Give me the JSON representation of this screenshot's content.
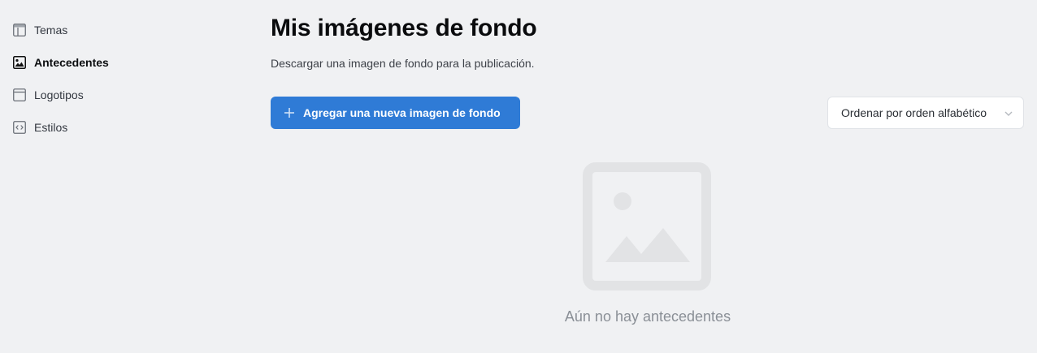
{
  "sidebar": {
    "items": [
      {
        "label": "Temas",
        "icon": "layout-icon",
        "active": false
      },
      {
        "label": "Antecedentes",
        "icon": "image-icon",
        "active": true
      },
      {
        "label": "Logotipos",
        "icon": "logo-icon",
        "active": false
      },
      {
        "label": "Estilos",
        "icon": "code-icon",
        "active": false
      }
    ]
  },
  "main": {
    "title": "Mis imágenes de fondo",
    "subtitle": "Descargar una imagen de fondo para la publicación.",
    "add_button": {
      "label": "Agregar una nueva imagen de fondo",
      "icon": "plus-icon"
    },
    "sort": {
      "selected": "Ordenar por orden alfabético",
      "icon": "chevron-down-icon"
    },
    "empty_state": {
      "text": "Aún no hay antecedentes",
      "icon": "image-placeholder-icon"
    }
  },
  "colors": {
    "background": "#f0f1f3",
    "primary": "#2f7bd6",
    "placeholder": "#e2e3e5"
  }
}
